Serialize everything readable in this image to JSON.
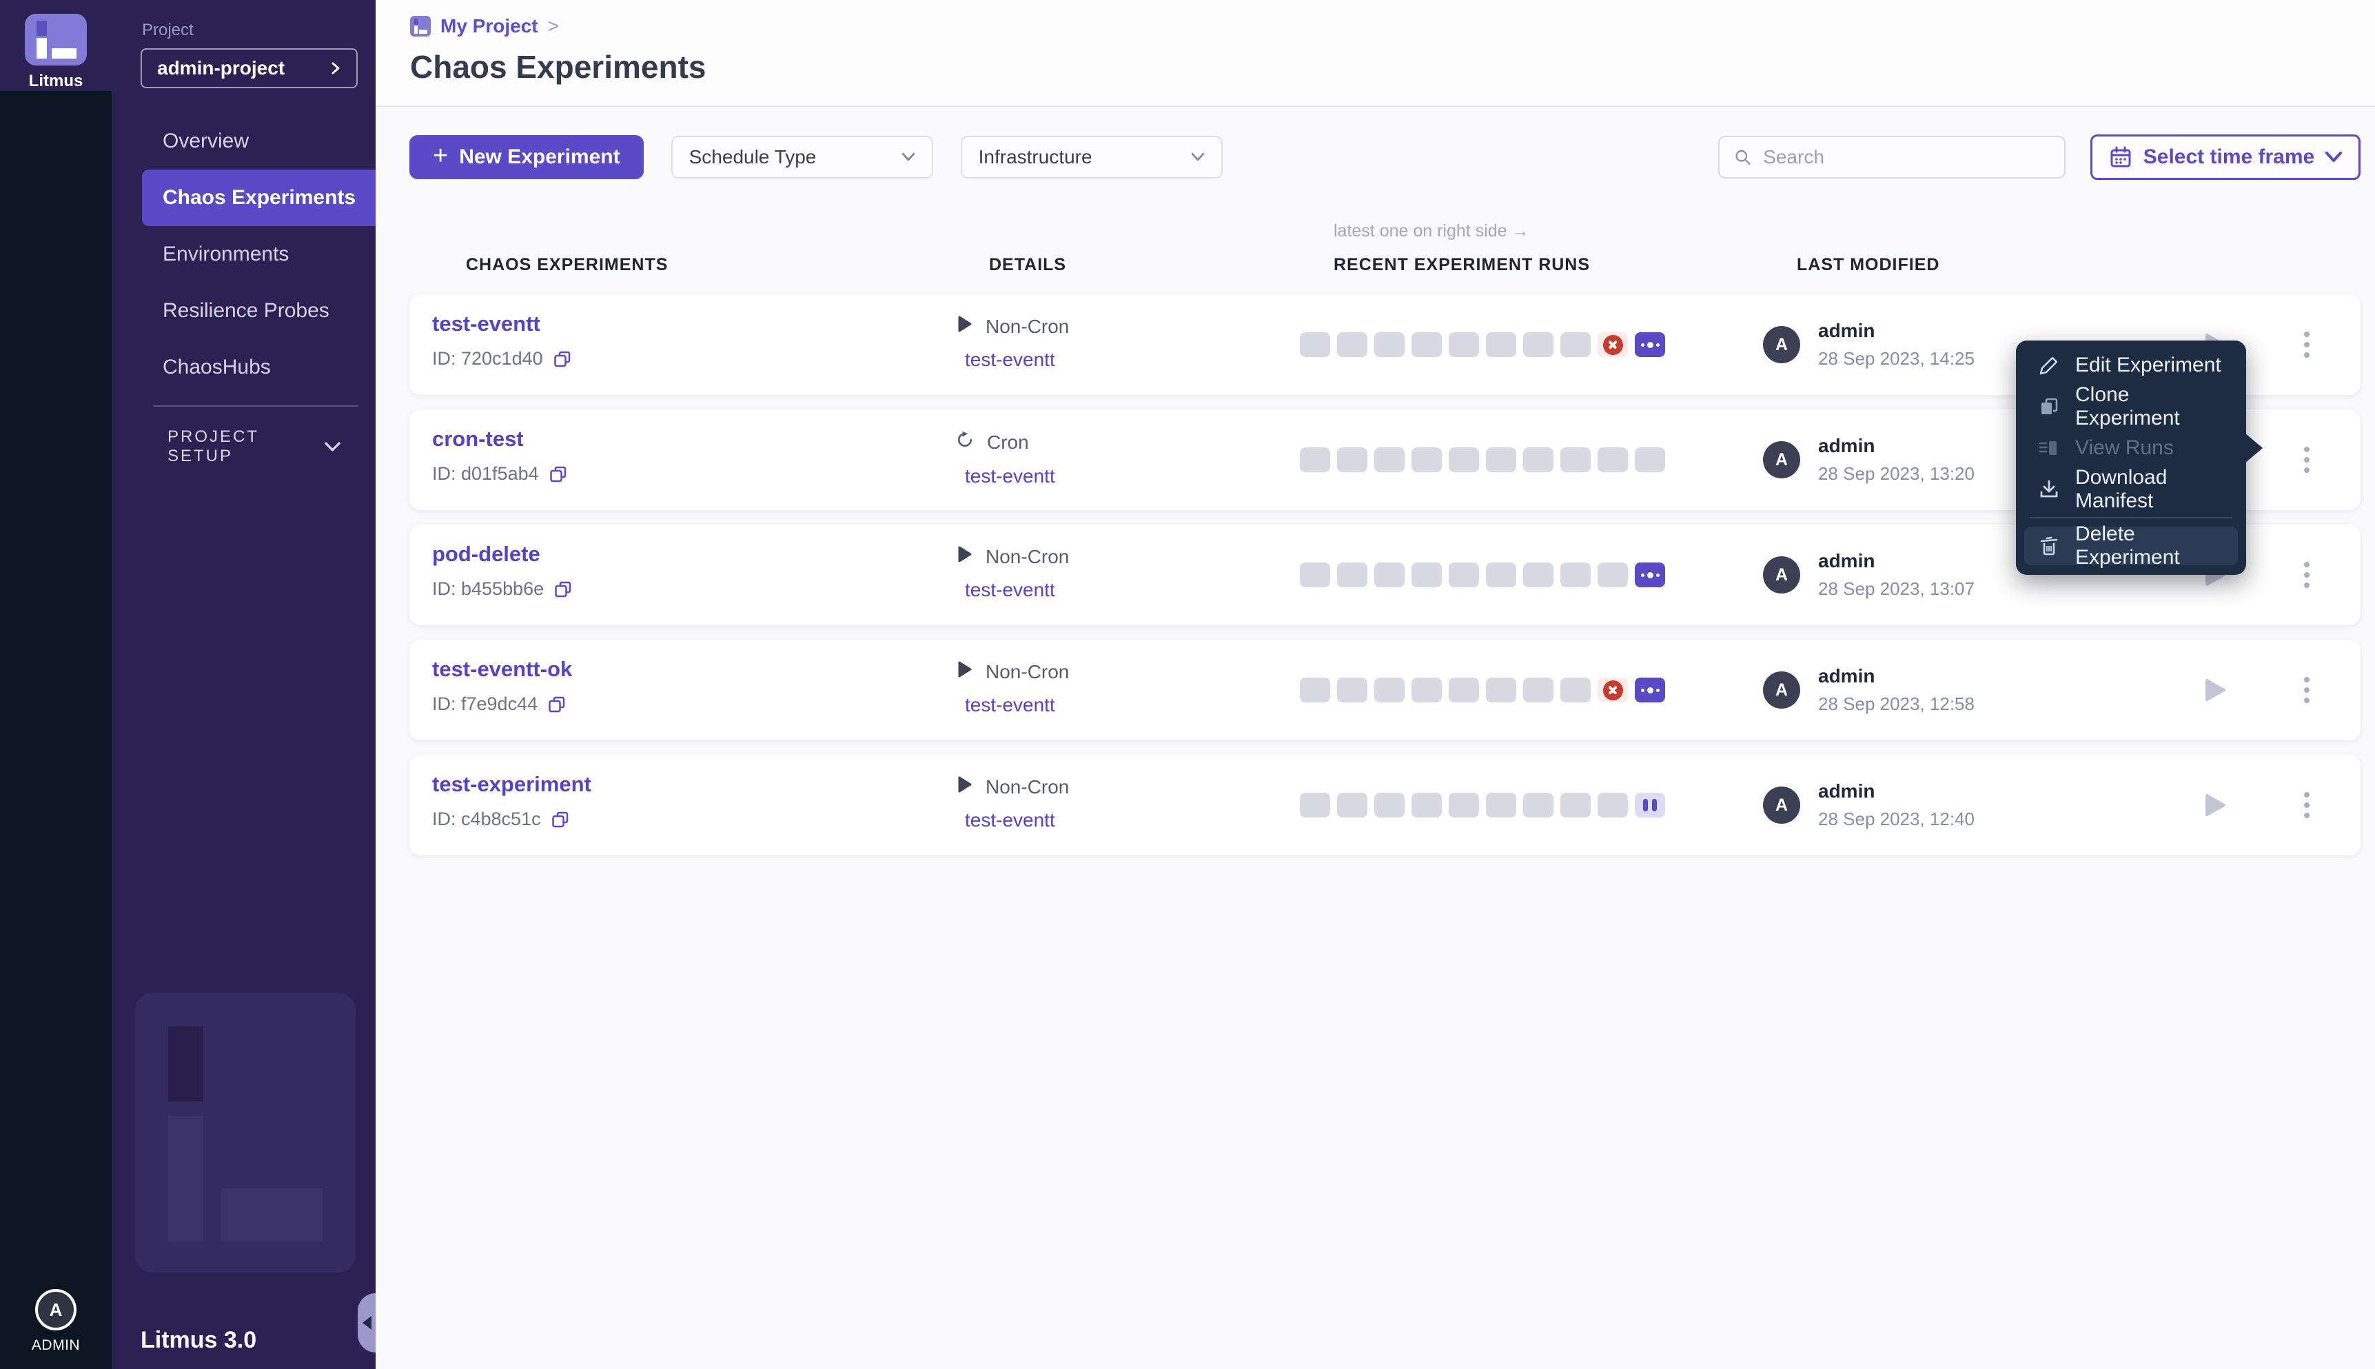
{
  "colors": {
    "accent": "#5b4ac8",
    "link": "#5243c9",
    "sidebar-bg": "#2b2153",
    "rail-bg": "#0b1622",
    "menu-bg": "#1d2b43",
    "logo-lavender": "#817ad7",
    "pill-gray": "#d9d9e4",
    "failed-red": "#c93a28",
    "failed-bg": "#fcebe8",
    "paused-bg": "#dedbf6"
  },
  "sidebar": {
    "brand": "Litmus",
    "project_label": "Project",
    "project_value": "admin-project",
    "nav": [
      {
        "label": "Overview",
        "active": false
      },
      {
        "label": "Chaos Experiments",
        "active": true
      },
      {
        "label": "Environments",
        "active": false
      },
      {
        "label": "Resilience Probes",
        "active": false
      },
      {
        "label": "ChaosHubs",
        "active": false
      }
    ],
    "section": "PROJECT SETUP",
    "version": "Litmus 3.0",
    "user": "ADMIN",
    "avatar_letter": "A"
  },
  "header": {
    "breadcrumb": "My Project",
    "separator": ">",
    "title": "Chaos Experiments"
  },
  "toolbar": {
    "new_experiment": "New Experiment",
    "plus": "+",
    "schedule_type": "Schedule Type",
    "infrastructure": "Infrastructure",
    "search_placeholder": "Search",
    "time_frame": "Select time frame"
  },
  "table": {
    "note": "latest one on right side →",
    "headers": {
      "experiments": "CHAOS EXPERIMENTS",
      "details": "DETAILS",
      "runs": "RECENT EXPERIMENT RUNS",
      "modified": "LAST MODIFIED"
    },
    "rows": [
      {
        "name": "test-eventt",
        "id": "ID: 720c1d40",
        "schedule": "Non-Cron",
        "schedule_icon": "play",
        "target": "test-eventt",
        "runs": [
          "gray",
          "gray",
          "gray",
          "gray",
          "gray",
          "gray",
          "gray",
          "gray",
          "failed",
          "more"
        ],
        "user": "admin",
        "avatar": "A",
        "modified": "28 Sep 2023, 14:25"
      },
      {
        "name": "cron-test",
        "id": "ID: d01f5ab4",
        "schedule": "Cron",
        "schedule_icon": "cron",
        "target": "test-eventt",
        "runs": [
          "gray",
          "gray",
          "gray",
          "gray",
          "gray",
          "gray",
          "gray",
          "gray",
          "gray",
          "gray"
        ],
        "user": "admin",
        "avatar": "A",
        "modified": "28 Sep 2023, 13:20"
      },
      {
        "name": "pod-delete",
        "id": "ID: b455bb6e",
        "schedule": "Non-Cron",
        "schedule_icon": "play",
        "target": "test-eventt",
        "runs": [
          "gray",
          "gray",
          "gray",
          "gray",
          "gray",
          "gray",
          "gray",
          "gray",
          "gray",
          "more"
        ],
        "user": "admin",
        "avatar": "A",
        "modified": "28 Sep 2023, 13:07"
      },
      {
        "name": "test-eventt-ok",
        "id": "ID: f7e9dc44",
        "schedule": "Non-Cron",
        "schedule_icon": "play",
        "target": "test-eventt",
        "runs": [
          "gray",
          "gray",
          "gray",
          "gray",
          "gray",
          "gray",
          "gray",
          "gray",
          "failed",
          "more"
        ],
        "user": "admin",
        "avatar": "A",
        "modified": "28 Sep 2023, 12:58"
      },
      {
        "name": "test-experiment",
        "id": "ID: c4b8c51c",
        "schedule": "Non-Cron",
        "schedule_icon": "play",
        "target": "test-eventt",
        "runs": [
          "gray",
          "gray",
          "gray",
          "gray",
          "gray",
          "gray",
          "gray",
          "gray",
          "gray",
          "paused"
        ],
        "user": "admin",
        "avatar": "A",
        "modified": "28 Sep 2023, 12:40"
      }
    ]
  },
  "menu": {
    "items": [
      {
        "label": "Edit Experiment",
        "icon": "pencil",
        "disabled": false,
        "highlighted": false,
        "separated": false
      },
      {
        "label": "Clone Experiment",
        "icon": "clone",
        "disabled": false,
        "highlighted": false,
        "separated": false
      },
      {
        "label": "View Runs",
        "icon": "runs",
        "disabled": true,
        "highlighted": false,
        "separated": false
      },
      {
        "label": "Download Manifest",
        "icon": "download",
        "disabled": false,
        "highlighted": false,
        "separated": false
      },
      {
        "label": "Delete Experiment",
        "icon": "trash",
        "disabled": false,
        "highlighted": true,
        "separated": true
      }
    ]
  }
}
